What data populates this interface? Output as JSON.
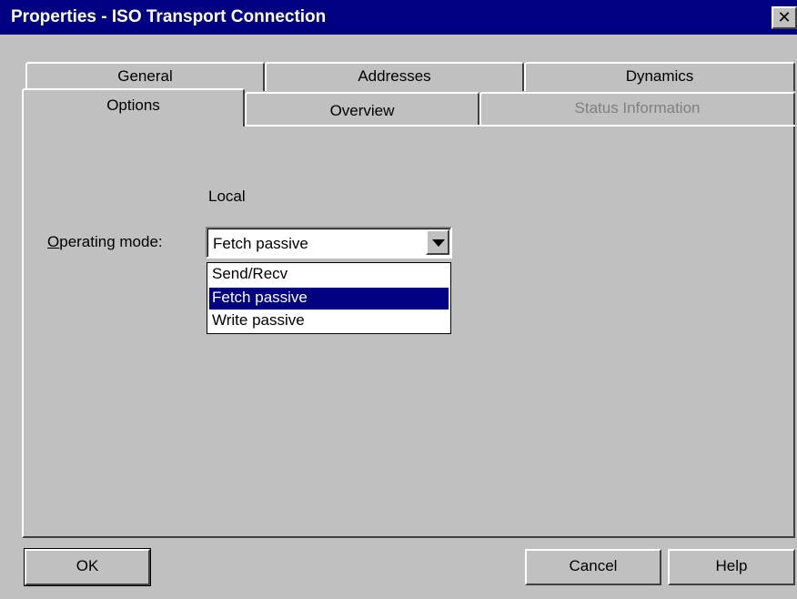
{
  "window": {
    "title": "Properties - ISO Transport Connection",
    "close_glyph": "✕"
  },
  "tabs": {
    "back_row": [
      {
        "label": "General"
      },
      {
        "label": "Addresses"
      },
      {
        "label": "Dynamics"
      }
    ],
    "front_row": [
      {
        "label": "Options",
        "active": true
      },
      {
        "label": "Overview"
      },
      {
        "label": "Status Information",
        "disabled": true
      }
    ]
  },
  "options_panel": {
    "column_header": "Local",
    "operating_mode": {
      "label_prefix_underlined": "O",
      "label_rest": "perating mode:",
      "selected_value": "Fetch passive",
      "options": [
        "Send/Recv",
        "Fetch passive",
        "Write passive"
      ],
      "highlighted_index": 1
    }
  },
  "buttons": {
    "ok": "OK",
    "cancel": "Cancel",
    "help": "Help"
  },
  "colors": {
    "titlebar": "#000080",
    "face": "#c0c0c0",
    "selection": "#000080"
  }
}
